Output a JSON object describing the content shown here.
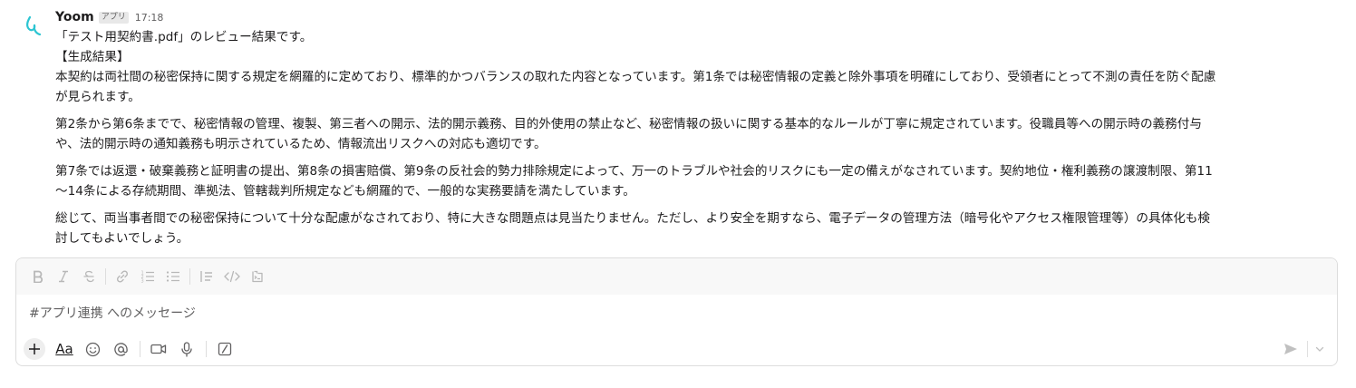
{
  "message": {
    "sender": "Yoom",
    "app_badge": "アプリ",
    "time": "17:18",
    "avatar_icon": "yoom-logo-icon",
    "accent_color": "#2cc5d2",
    "line1": "「テスト用契約書.pdf」のレビュー結果です。",
    "line2": "【生成結果】",
    "paragraphs": [
      {
        "l1": "本契約は両社間の秘密保持に関する規定を網羅的に定めており、標準的かつバランスの取れた内容となっています。第1条では秘密情報の定義と除外事項を明確にしており、受領者にとって不測の責任を防ぐ配慮",
        "l2": "が見られます。"
      },
      {
        "l1": "第2条から第6条までで、秘密情報の管理、複製、第三者への開示、法的開示義務、目的外使用の禁止など、秘密情報の扱いに関する基本的なルールが丁寧に規定されています。役職員等への開示時の義務付与",
        "l2": "や、法的開示時の通知義務も明示されているため、情報流出リスクへの対応も適切です。"
      },
      {
        "l1": "第7条では返還・破棄義務と証明書の提出、第8条の損害賠償、第9条の反社会的勢力排除規定によって、万一のトラブルや社会的リスクにも一定の備えがなされています。契約地位・権利義務の譲渡制限、第11",
        "l2": "〜14条による存続期間、準拠法、管轄裁判所規定なども網羅的で、一般的な実務要請を満たしています。"
      },
      {
        "l1": "総じて、両当事者間での秘密保持について十分な配慮がなされており、特に大きな問題点は見当たりません。ただし、より安全を期すなら、電子データの管理方法（暗号化やアクセス権限管理等）の具体化も検",
        "l2": "討してもよいでしょう。"
      }
    ]
  },
  "composer": {
    "placeholder": "#アプリ連携 へのメッセージ",
    "aa_label": "Aa",
    "formatting_icons": [
      "bold-icon",
      "italic-icon",
      "strikethrough-icon",
      "link-icon",
      "ordered-list-icon",
      "bulleted-list-icon",
      "blockquote-icon",
      "code-icon",
      "code-block-icon"
    ],
    "toolbar_icons": [
      "plus-icon",
      "format-text-icon",
      "emoji-icon",
      "mention-icon",
      "video-icon",
      "microphone-icon",
      "slash-command-icon",
      "send-icon",
      "chevron-down-icon"
    ]
  }
}
